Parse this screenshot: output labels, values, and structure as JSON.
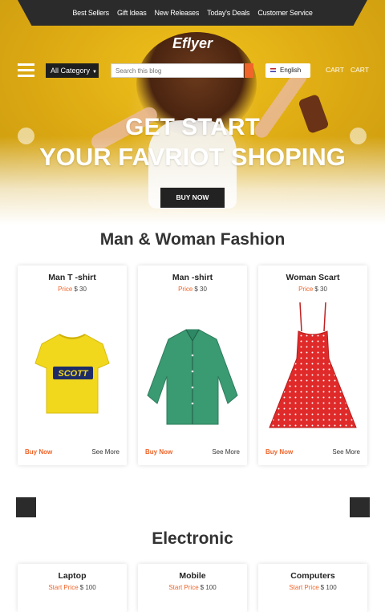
{
  "topnav": [
    "Best Sellers",
    "Gift Ideas",
    "New Releases",
    "Today's Deals",
    "Customer Service"
  ],
  "logo": "Eflyer",
  "category_select": "All Category",
  "search_placeholder": "Search this blog",
  "language": "English",
  "cart_labels": [
    "CART",
    "CART"
  ],
  "hero": {
    "line1": "GET START",
    "line2": "YOUR FAVRIOT SHOPING",
    "button": "BUY NOW"
  },
  "sections": [
    {
      "title": "Man & Woman Fashion",
      "products": [
        {
          "name": "Man T -shirt",
          "price_label": "Price",
          "price": "$ 30",
          "buy": "Buy Now",
          "more": "See More"
        },
        {
          "name": "Man -shirt",
          "price_label": "Price",
          "price": "$ 30",
          "buy": "Buy Now",
          "more": "See More"
        },
        {
          "name": "Woman Scart",
          "price_label": "Price",
          "price": "$ 30",
          "buy": "Buy Now",
          "more": "See More"
        }
      ]
    },
    {
      "title": "Electronic",
      "products": [
        {
          "name": "Laptop",
          "price_label": "Start Price",
          "price": "$ 100"
        },
        {
          "name": "Mobile",
          "price_label": "Start Price",
          "price": "$ 100"
        },
        {
          "name": "Computers",
          "price_label": "Start Price",
          "price": "$ 100"
        }
      ]
    }
  ],
  "tshirt_print": "SCOTT",
  "colors": {
    "accent": "#f0652a",
    "dark": "#2b2b2b",
    "hero": "#e0b416"
  }
}
